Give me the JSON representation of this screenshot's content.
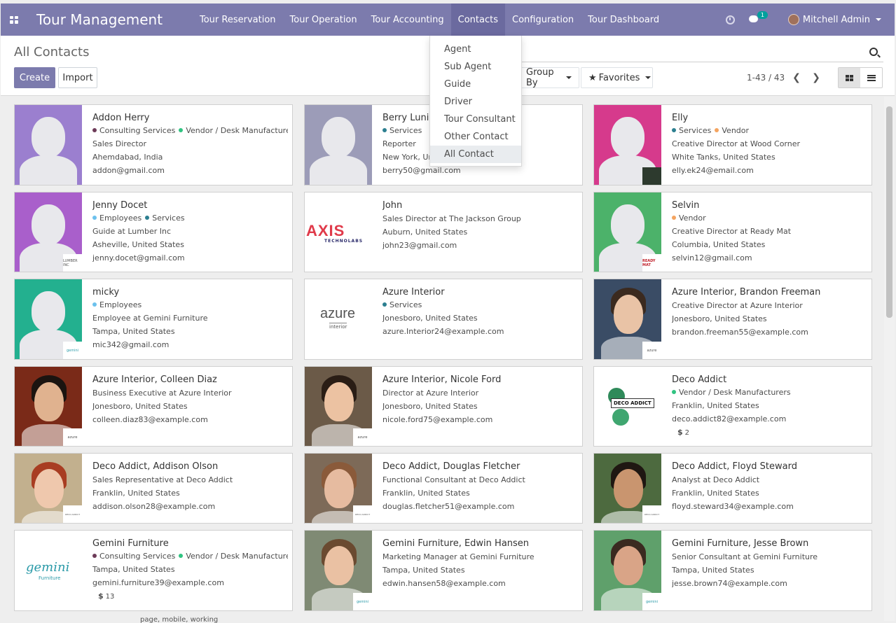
{
  "app": {
    "title": "Tour Management"
  },
  "menu": [
    {
      "label": "Tour Reservation"
    },
    {
      "label": "Tour Operation"
    },
    {
      "label": "Tour Accounting"
    },
    {
      "label": "Contacts"
    },
    {
      "label": "Configuration"
    },
    {
      "label": "Tour Dashboard"
    }
  ],
  "systray": {
    "chat_count": "1",
    "user_name": "Mitchell Admin"
  },
  "control": {
    "breadcrumb": "All Contacts",
    "create_label": "Create",
    "import_label": "Import",
    "search_placeholder": "",
    "group_by_label": "Group By",
    "favorites_label": "Favorites",
    "pager": "1-43 / 43"
  },
  "contacts_dropdown": [
    {
      "label": "Agent"
    },
    {
      "label": "Sub Agent"
    },
    {
      "label": "Guide"
    },
    {
      "label": "Driver"
    },
    {
      "label": "Tour Consultant"
    },
    {
      "label": "Other Contact"
    },
    {
      "label": "All Contact"
    }
  ],
  "tag_colors": {
    "Consulting Services": "#6d3b58",
    "Vendor / Desk Manufacturers": "#30c381",
    "Services": "#2c7f90",
    "Vendor": "#f4a460",
    "Employees": "#6cc1ed"
  },
  "cards": [
    {
      "name": "Addon Herry",
      "tags": [
        "Consulting Services",
        "Vendor / Desk Manufacturers"
      ],
      "lines": [
        "Sales Director",
        "Ahemdabad, India",
        "addon@gmail.com"
      ]
    },
    {
      "name": "Berry Lunio",
      "tags": [
        "Services"
      ],
      "lines": [
        "Reporter",
        "New York, Un",
        "berry50@gmail.com"
      ]
    },
    {
      "name": "Elly",
      "tags": [
        "Services",
        "Vendor"
      ],
      "lines": [
        "Creative Director at Wood Corner",
        "White Tanks, United States",
        "elly.ek24@email.com"
      ]
    },
    {
      "name": "Jenny Docet",
      "tags": [
        "Employees",
        "Services"
      ],
      "lines": [
        "Guide at Lumber Inc",
        "Asheville, United States",
        "jenny.docet@gmail.com"
      ]
    },
    {
      "name": "John",
      "tags": [],
      "lines": [
        "Sales Director at The Jackson Group",
        "Auburn, United States",
        "john23@gmail.com"
      ]
    },
    {
      "name": "Selvin",
      "tags": [
        "Vendor"
      ],
      "lines": [
        "Creative Director at Ready Mat",
        "Columbia, United States",
        "selvin12@gmail.com"
      ]
    },
    {
      "name": "micky",
      "tags": [
        "Employees"
      ],
      "lines": [
        "Employee at Gemini Furniture",
        "Tampa, United States",
        "mic342@gmail.com"
      ]
    },
    {
      "name": "Azure Interior",
      "tags": [
        "Services"
      ],
      "lines": [
        "Jonesboro, United States",
        "azure.Interior24@example.com"
      ]
    },
    {
      "name": "Azure Interior, Brandon Freeman",
      "tags": [],
      "lines": [
        "Creative Director at Azure Interior",
        "Jonesboro, United States",
        "brandon.freeman55@example.com"
      ]
    },
    {
      "name": "Azure Interior, Colleen Diaz",
      "tags": [],
      "lines": [
        "Business Executive at Azure Interior",
        "Jonesboro, United States",
        "colleen.diaz83@example.com"
      ]
    },
    {
      "name": "Azure Interior, Nicole Ford",
      "tags": [],
      "lines": [
        "Director at Azure Interior",
        "Jonesboro, United States",
        "nicole.ford75@example.com"
      ]
    },
    {
      "name": "Deco Addict",
      "tags": [
        "Vendor / Desk Manufacturers"
      ],
      "lines": [
        "Franklin, United States",
        "deco.addict82@example.com"
      ],
      "money": "2"
    },
    {
      "name": "Deco Addict, Addison Olson",
      "tags": [],
      "lines": [
        "Sales Representative at Deco Addict",
        "Franklin, United States",
        "addison.olson28@example.com"
      ]
    },
    {
      "name": "Deco Addict, Douglas Fletcher",
      "tags": [],
      "lines": [
        "Functional Consultant at Deco Addict",
        "Franklin, United States",
        "douglas.fletcher51@example.com"
      ]
    },
    {
      "name": "Deco Addict, Floyd Steward",
      "tags": [],
      "lines": [
        "Analyst at Deco Addict",
        "Franklin, United States",
        "floyd.steward34@example.com"
      ]
    },
    {
      "name": "Gemini Furniture",
      "tags": [
        "Consulting Services",
        "Vendor / Desk Manufacturers"
      ],
      "lines": [
        "Tampa, United States",
        "gemini.furniture39@example.com"
      ],
      "money": "13"
    },
    {
      "name": "Gemini Furniture, Edwin Hansen",
      "tags": [],
      "lines": [
        "Marketing Manager at Gemini Furniture",
        "Tampa, United States",
        "edwin.hansen58@example.com"
      ]
    },
    {
      "name": "Gemini Furniture, Jesse Brown",
      "tags": [],
      "lines": [
        "Senior Consultant at Gemini Furniture",
        "Tampa, United States",
        "jesse.brown74@example.com"
      ]
    }
  ],
  "logos": {
    "axis": "AXIS",
    "axis_sub": "TECHNOLABS",
    "azure": "azure",
    "azure_sub": "interior",
    "deco": "DECO ADDICT",
    "gemini": "gemini",
    "gemini_sub": "Furniture",
    "lumber": "LUMBER INC",
    "ready": "READY MAT"
  },
  "footer_text": "page, mobile, working"
}
